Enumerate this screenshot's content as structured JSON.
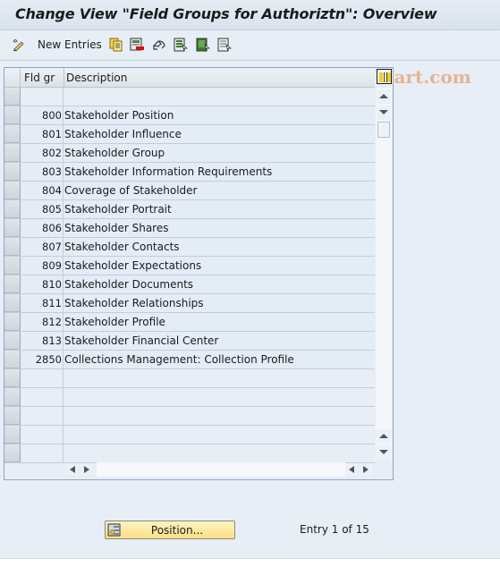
{
  "window": {
    "title": "Change View \"Field Groups for Authoriztn\": Overview"
  },
  "toolbar": {
    "new_entries_label": "New Entries",
    "icons": [
      "change-display-icon",
      "copy-icon",
      "delete-icon",
      "undo-change-icon",
      "select-all-icon",
      "select-block-icon",
      "deselect-all-icon"
    ],
    "watermark": "© www.tutorialkart.com"
  },
  "table": {
    "columns": [
      {
        "key": "fld_gr",
        "label": "Fld gr"
      },
      {
        "key": "description",
        "label": "Description"
      }
    ],
    "rows": [
      {
        "fld_gr": "",
        "description": ""
      },
      {
        "fld_gr": "800",
        "description": "Stakeholder Position"
      },
      {
        "fld_gr": "801",
        "description": "Stakeholder Influence"
      },
      {
        "fld_gr": "802",
        "description": "Stakeholder Group"
      },
      {
        "fld_gr": "803",
        "description": "Stakeholder Information Requirements"
      },
      {
        "fld_gr": "804",
        "description": "Coverage of Stakeholder"
      },
      {
        "fld_gr": "805",
        "description": "Stakeholder Portrait"
      },
      {
        "fld_gr": "806",
        "description": "Stakeholder Shares"
      },
      {
        "fld_gr": "807",
        "description": "Stakeholder Contacts"
      },
      {
        "fld_gr": "809",
        "description": "Stakeholder Expectations"
      },
      {
        "fld_gr": "810",
        "description": "Stakeholder Documents"
      },
      {
        "fld_gr": "811",
        "description": "Stakeholder Relationships"
      },
      {
        "fld_gr": "812",
        "description": "Stakeholder Profile"
      },
      {
        "fld_gr": "813",
        "description": "Stakeholder Financial Center"
      },
      {
        "fld_gr": "2850",
        "description": "Collections Management: Collection Profile"
      },
      {
        "fld_gr": "",
        "description": ""
      },
      {
        "fld_gr": "",
        "description": ""
      },
      {
        "fld_gr": "",
        "description": ""
      },
      {
        "fld_gr": "",
        "description": ""
      },
      {
        "fld_gr": "",
        "description": ""
      }
    ]
  },
  "footer": {
    "position_button_label": "Position...",
    "entry_info": "Entry 1 of 15"
  }
}
